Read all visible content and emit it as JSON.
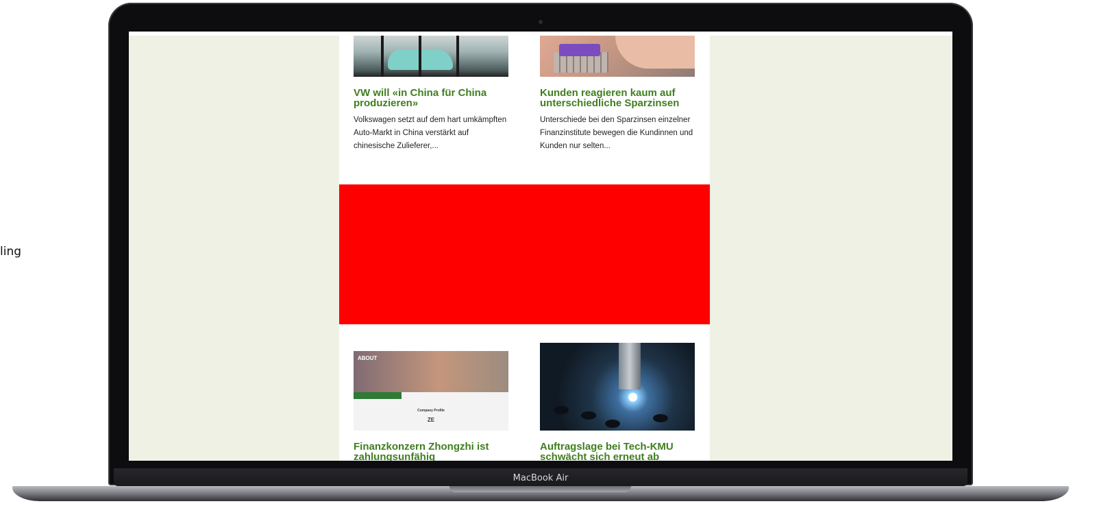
{
  "side_text": "ling",
  "device_label": "MacBook Air",
  "articles": [
    {
      "headline": "VW will «in China für China produzieren»",
      "teaser": "Volkswagen setzt auf dem hart umkämpften Auto-Markt in China verstärkt auf chinesische Zulieferer,..."
    },
    {
      "headline": "Kunden reagieren kaum auf unterschiedliche Sparzinsen",
      "teaser": "Unterschiede bei den Sparzinsen einzelner Finanzinstitute bewegen die Kundinnen und Kunden nur selten..."
    },
    {
      "headline": "Finanzkonzern Zhongzhi ist zahlungsunfähig",
      "thumb_hero": "ABOUT",
      "thumb_caption": "Company Profile",
      "thumb_logo": "ZE"
    },
    {
      "headline": "Auftragslage bei Tech-KMU schwächt sich erneut ab"
    }
  ],
  "colors": {
    "headline": "#3f7e1f",
    "ad_banner": "#ff0000",
    "screen_background": "#eef1e4"
  }
}
